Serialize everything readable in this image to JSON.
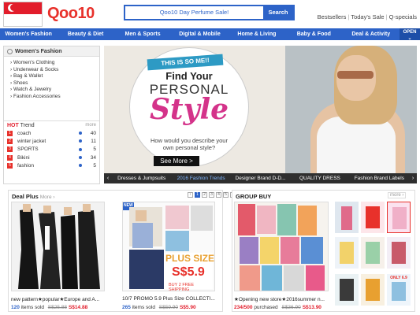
{
  "header": {
    "logo": "Qoo10",
    "search_value": "Qoo10 Day Perfume Sale!",
    "search_button": "Search",
    "links": [
      "Bestsellers",
      "Today's Sale",
      "Q-specials"
    ]
  },
  "nav": {
    "items": [
      "Women's Fashion",
      "Beauty & Diet",
      "Men & Sports",
      "Digital & Mobile",
      "Home & Living",
      "Baby & Food",
      "Deal & Activity"
    ],
    "open_label": "OPEN"
  },
  "sidebar": {
    "heading": "Women's Fashion",
    "categories": [
      "Women's Clothing",
      "Underwear & Socks",
      "Bag & Wallet",
      "Shoes",
      "Watch & Jewelry",
      "Fashion Accessories"
    ],
    "hot_trend": {
      "label_hot": "HOT",
      "label_trend": "Trend",
      "more": "more",
      "items": [
        {
          "rank": "1",
          "name": "coach",
          "count": "40"
        },
        {
          "rank": "2",
          "name": "winter jacket",
          "count": "11"
        },
        {
          "rank": "3",
          "name": "SPORTS",
          "count": "5"
        },
        {
          "rank": "4",
          "name": "Bikini",
          "count": "34"
        },
        {
          "rank": "5",
          "name": "fashion",
          "count": "5"
        }
      ]
    }
  },
  "banner": {
    "ribbon": "THIS IS SO ME!!",
    "line1": "Find Your",
    "line2": "PERSONAL",
    "line3": "Style",
    "question": "How would you describe your own personal style?",
    "cta": "See More >",
    "tabs": [
      "Dresses & Jumpsuits",
      "2016 Fashion Trends",
      "Designer Brand D-D...",
      "QUALITY DRESS",
      "Fashion Brand Labels"
    ],
    "active_tab": 1
  },
  "deal_plus": {
    "title": "Deal Plus",
    "more": "More",
    "pages": [
      "1",
      "2",
      "3",
      "4",
      "5"
    ],
    "products": [
      {
        "caption": "new pattern★popular★Europe and A...",
        "sold": "120",
        "sold_label": "items sold",
        "orig": "S$25.88",
        "sale": "S$14.88"
      },
      {
        "caption": "10/7 PROMO 5.9 Plus Size COLLECTI...",
        "sold": "265",
        "sold_label": "items sold",
        "orig": "S$59.90",
        "sale": "S$5.90",
        "badge_top": "PLUS SIZE",
        "badge_price": "S$5.9",
        "badge_ship": "BUY 2 FREE SHIPPING",
        "badge_new": "NEW"
      }
    ]
  },
  "group_buy": {
    "title": "GROUP BUY",
    "more": "more",
    "product": {
      "caption": "★Opening new store★2016summer n...",
      "sold": "234/500",
      "sold_label": "purchased",
      "orig": "S$36.90",
      "sale": "S$13.90"
    },
    "thumb_labels": [
      "ONLY 6.9"
    ]
  },
  "colors": {
    "brand_blue": "#2d63c8",
    "brand_red": "#e8312b"
  }
}
